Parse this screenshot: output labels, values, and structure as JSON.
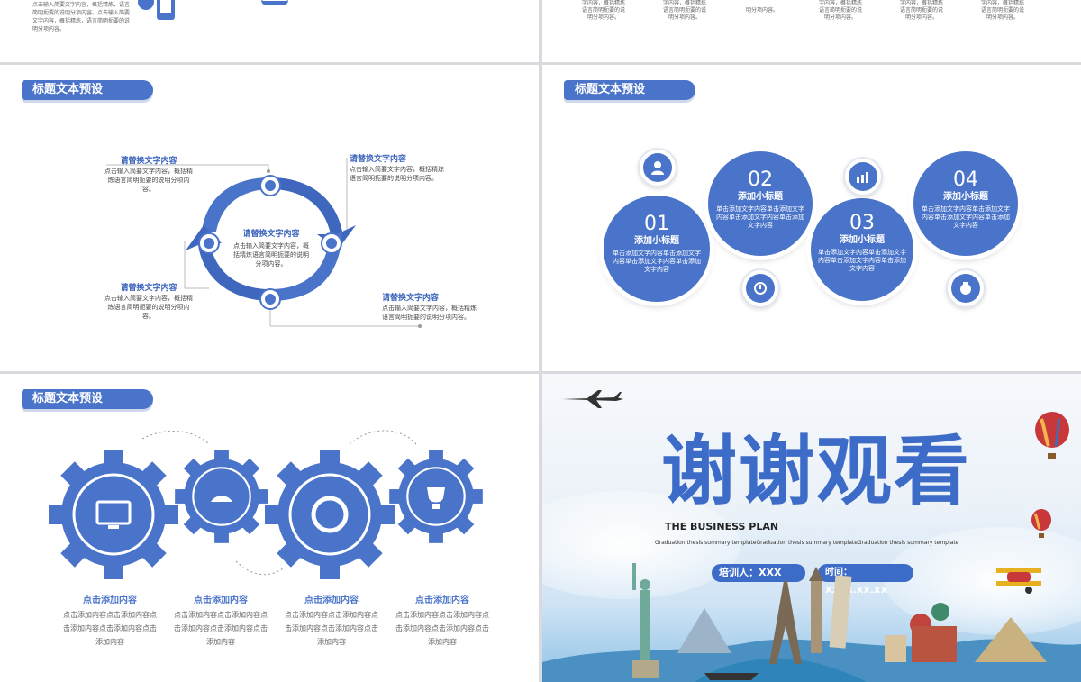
{
  "slide_title": "标题文本预设",
  "top_left": {
    "text": "点击输入简要文字内容，概括精炼，语言简明扼要的说明分项内容。点击输入简要文字内容，概括精炼，语言简明扼要的说明分项内容。"
  },
  "top_right": {
    "items": [
      "字内容，概括精炼语言简明扼要的说明分项内容。",
      "字内容，概括精炼语言简明扼要的说明分项内容。",
      "明分项内容。",
      "字内容，概括精炼语言简明扼要的说明分项内容。",
      "字内容，概括精炼语言简明扼要的说明分项内容。",
      "字内容，概括精炼语言简明扼要的说明分项内容。"
    ]
  },
  "cycle": {
    "center_title": "请替换文字内容",
    "center_text": "点击输入简要文字内容，概括精炼语言简明扼要的说明分项内容。",
    "items": [
      {
        "title": "请替换文字内容",
        "text": "点击输入简要文字内容，概括精炼语言简明扼要的说明分项内容。"
      },
      {
        "title": "请替换文字内容",
        "text": "点击输入简要文字内容，概括精炼语言简明扼要的说明分项内容。"
      },
      {
        "title": "请替换文字内容",
        "text": "点击输入简要文字内容，概括精炼语言简明扼要的说明分项内容。"
      },
      {
        "title": "请替换文字内容",
        "text": "点击输入简要文字内容，概括精炼语言简明扼要的说明分项内容。"
      }
    ]
  },
  "bubbles": {
    "items": [
      {
        "num": "01",
        "title": "添加小标题",
        "text": "单击添加文字内容单击添加文字内容单击添加文字内容单击添加文字内容"
      },
      {
        "num": "02",
        "title": "添加小标题",
        "text": "单击添加文字内容单击添加文字内容单击添加文字内容单击添加文字内容"
      },
      {
        "num": "03",
        "title": "添加小标题",
        "text": "单击添加文字内容单击添加文字内容单击添加文字内容单击添加文字内容"
      },
      {
        "num": "04",
        "title": "添加小标题",
        "text": "单击添加文字内容单击添加文字内容单击添加文字内容单击添加文字内容"
      }
    ]
  },
  "gears": {
    "items": [
      {
        "title": "点击添加内容",
        "text": "点击添加内容点击添加内容点击添加内容点击添加内容点击添加内容"
      },
      {
        "title": "点击添加内容",
        "text": "点击添加内容点击添加内容点击添加内容点击添加内容点击添加内容"
      },
      {
        "title": "点击添加内容",
        "text": "点击添加内容点击添加内容点击添加内容点击添加内容点击添加内容"
      },
      {
        "title": "点击添加内容",
        "text": "点击添加内容点击添加内容点击添加内容点击添加内容点击添加内容"
      }
    ]
  },
  "thanks": {
    "title": "谢谢观看",
    "subtitle": "THE BUSINESS PLAN",
    "tagline": "Graduation thesis summary templateGraduation thesis summary templateGraduation thesis summary template",
    "trainer": "培训人：XXX",
    "time": "时间：XXXX.XX.XX"
  },
  "colors": {
    "accent": "#4a74c9",
    "accent_dark": "#3f67bd"
  }
}
